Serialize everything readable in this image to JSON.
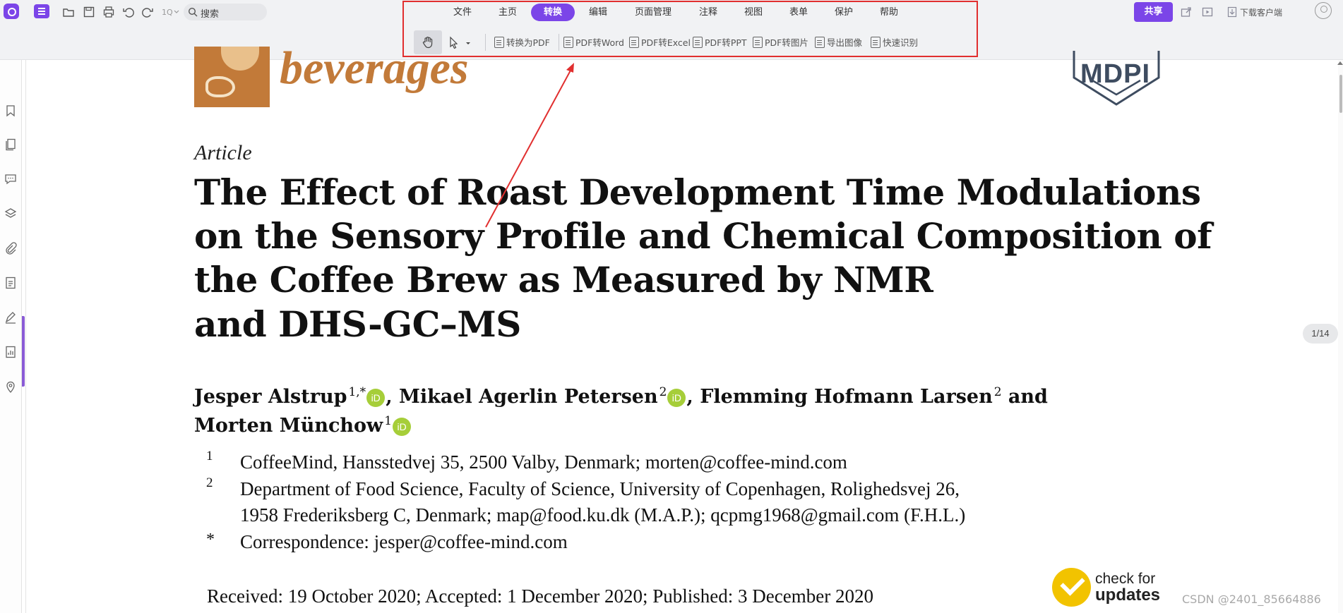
{
  "titlebar": {
    "search_label": "搜索",
    "menu_tabs": [
      "文件",
      "主页",
      "转换",
      "编辑",
      "页面管理",
      "注释",
      "视图",
      "表单",
      "保护",
      "帮助"
    ],
    "active_tab": "转换",
    "share_label": "共享",
    "download_client_label": "下载客户端"
  },
  "convert_toolbar": {
    "items": [
      "转换为PDF",
      "PDF转Word",
      "PDF转Excel",
      "PDF转PPT",
      "PDF转图片",
      "导出图像",
      "快速识别"
    ]
  },
  "sidebar": {
    "icons": [
      "bookmark-icon",
      "pages-icon",
      "comment-icon",
      "layers-icon",
      "attachment-icon",
      "form-icon",
      "signature-icon",
      "document-stats-icon",
      "location-icon"
    ]
  },
  "document": {
    "journal_name": "beverages",
    "publisher": "MDPI",
    "article_type": "Article",
    "title_lines": [
      "The Effect of Roast Development Time Modulations",
      "on the Sensory Profile and Chemical Composition of",
      "the Coffee Brew as Measured by NMR",
      "and DHS-GC–MS"
    ],
    "authors_line1": {
      "a1": "Jesper Alstrup",
      "a1_sup": "1,*",
      "a2": ", Mikael Agerlin Petersen",
      "a2_sup": "2",
      "a3": ", Flemming Hofmann Larsen",
      "a3_sup": "2",
      "a3_tail": " and"
    },
    "authors_line2": {
      "a4": "Morten Münchow",
      "a4_sup": "1"
    },
    "orcid_label": "iD",
    "affiliations": [
      {
        "num": "1",
        "lines": [
          "CoffeeMind, Hansstedvej 35, 2500 Valby, Denmark; morten@coffee-mind.com"
        ]
      },
      {
        "num": "2",
        "lines": [
          "Department of Food Science, Faculty of Science, University of Copenhagen, Rolighedsvej 26,",
          "1958 Frederiksberg C, Denmark; map@food.ku.dk (M.A.P.); qcpmg1968@gmail.com (F.H.L.)"
        ]
      },
      {
        "num": "*",
        "lines": [
          "Correspondence: jesper@coffee-mind.com"
        ]
      }
    ],
    "dates": "Received: 19 October 2020; Accepted: 1 December 2020; Published: 3 December 2020",
    "check_updates_line1": "check for",
    "check_updates_line2": "updates"
  },
  "page_indicator": "1/14",
  "watermark": "CSDN @2401_85664886",
  "colors": {
    "accent": "#7b45e8",
    "annotation_red": "#e12f2f",
    "journal_brown": "#c27a39",
    "orcid_green": "#a6ce39"
  }
}
